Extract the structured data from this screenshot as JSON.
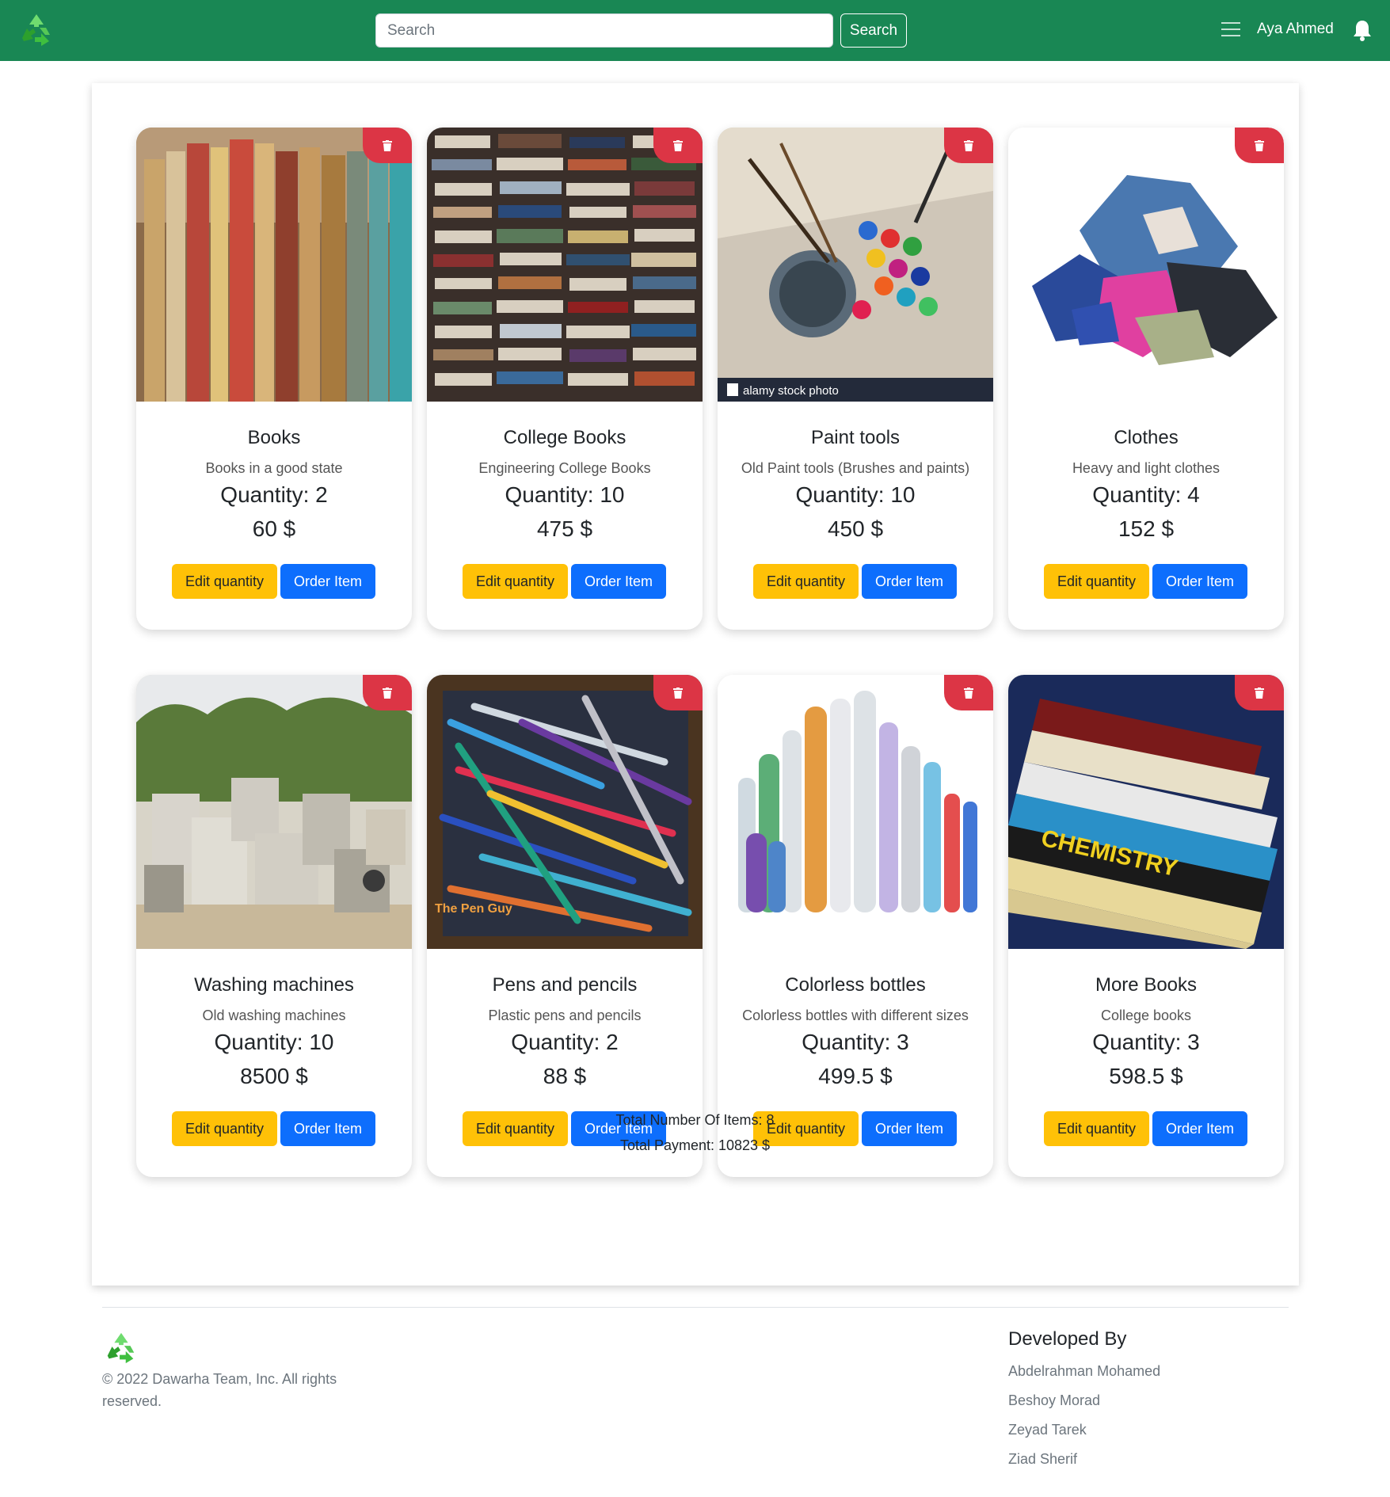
{
  "navbar": {
    "search_placeholder": "Search",
    "search_value": "",
    "search_button": "Search",
    "user_name": "Aya Ahmed"
  },
  "items": [
    {
      "title": "Books",
      "description": "Books in a good state",
      "quantity_label": "Quantity: 2",
      "price": "60 $",
      "image": "books-on-shelf-photo"
    },
    {
      "title": "College Books",
      "description": "Engineering College Books",
      "quantity_label": "Quantity: 10",
      "price": "475 $",
      "image": "stacked-books-photo"
    },
    {
      "title": "Paint tools",
      "description": "Old Paint tools (Brushes and paints)",
      "quantity_label": "Quantity: 10",
      "price": "450 $",
      "image": "paint-tools-photo",
      "image_caption": "alamy stock photo"
    },
    {
      "title": "Clothes",
      "description": "Heavy and light clothes",
      "quantity_label": "Quantity: 4",
      "price": "152 $",
      "image": "clothes-pile-photo"
    },
    {
      "title": "Washing machines",
      "description": "Old washing machines",
      "quantity_label": "Quantity: 10",
      "price": "8500 $",
      "image": "scrap-appliances-photo"
    },
    {
      "title": "Pens and pencils",
      "description": "Plastic pens and pencils",
      "quantity_label": "Quantity: 2",
      "price": "88 $",
      "image": "pens-box-photo",
      "image_caption": "The Pen Guy"
    },
    {
      "title": "Colorless bottles",
      "description": "Colorless bottles with different sizes",
      "quantity_label": "Quantity: 3",
      "price": "499.5 $",
      "image": "bottles-photo"
    },
    {
      "title": "More Books",
      "description": "College books",
      "quantity_label": "Quantity: 3",
      "price": "598.5 $",
      "image": "textbook-stack-photo"
    }
  ],
  "buttons": {
    "edit": "Edit quantity",
    "order": "Order Item"
  },
  "totals": {
    "items": "Total Number Of Items: 8",
    "payment": "Total Payment: 10823 $"
  },
  "footer": {
    "copyright": "© 2022 Dawarha Team, Inc. All rights reserved.",
    "developed_by_title": "Developed By",
    "developers": [
      "Abdelrahman Mohamed",
      "Beshoy Morad",
      "Zeyad Tarek",
      "Ziad Sherif"
    ]
  },
  "colors": {
    "navbar": "#198754",
    "delete": "#dc3545",
    "edit": "#ffc107",
    "order": "#0d6efd"
  }
}
